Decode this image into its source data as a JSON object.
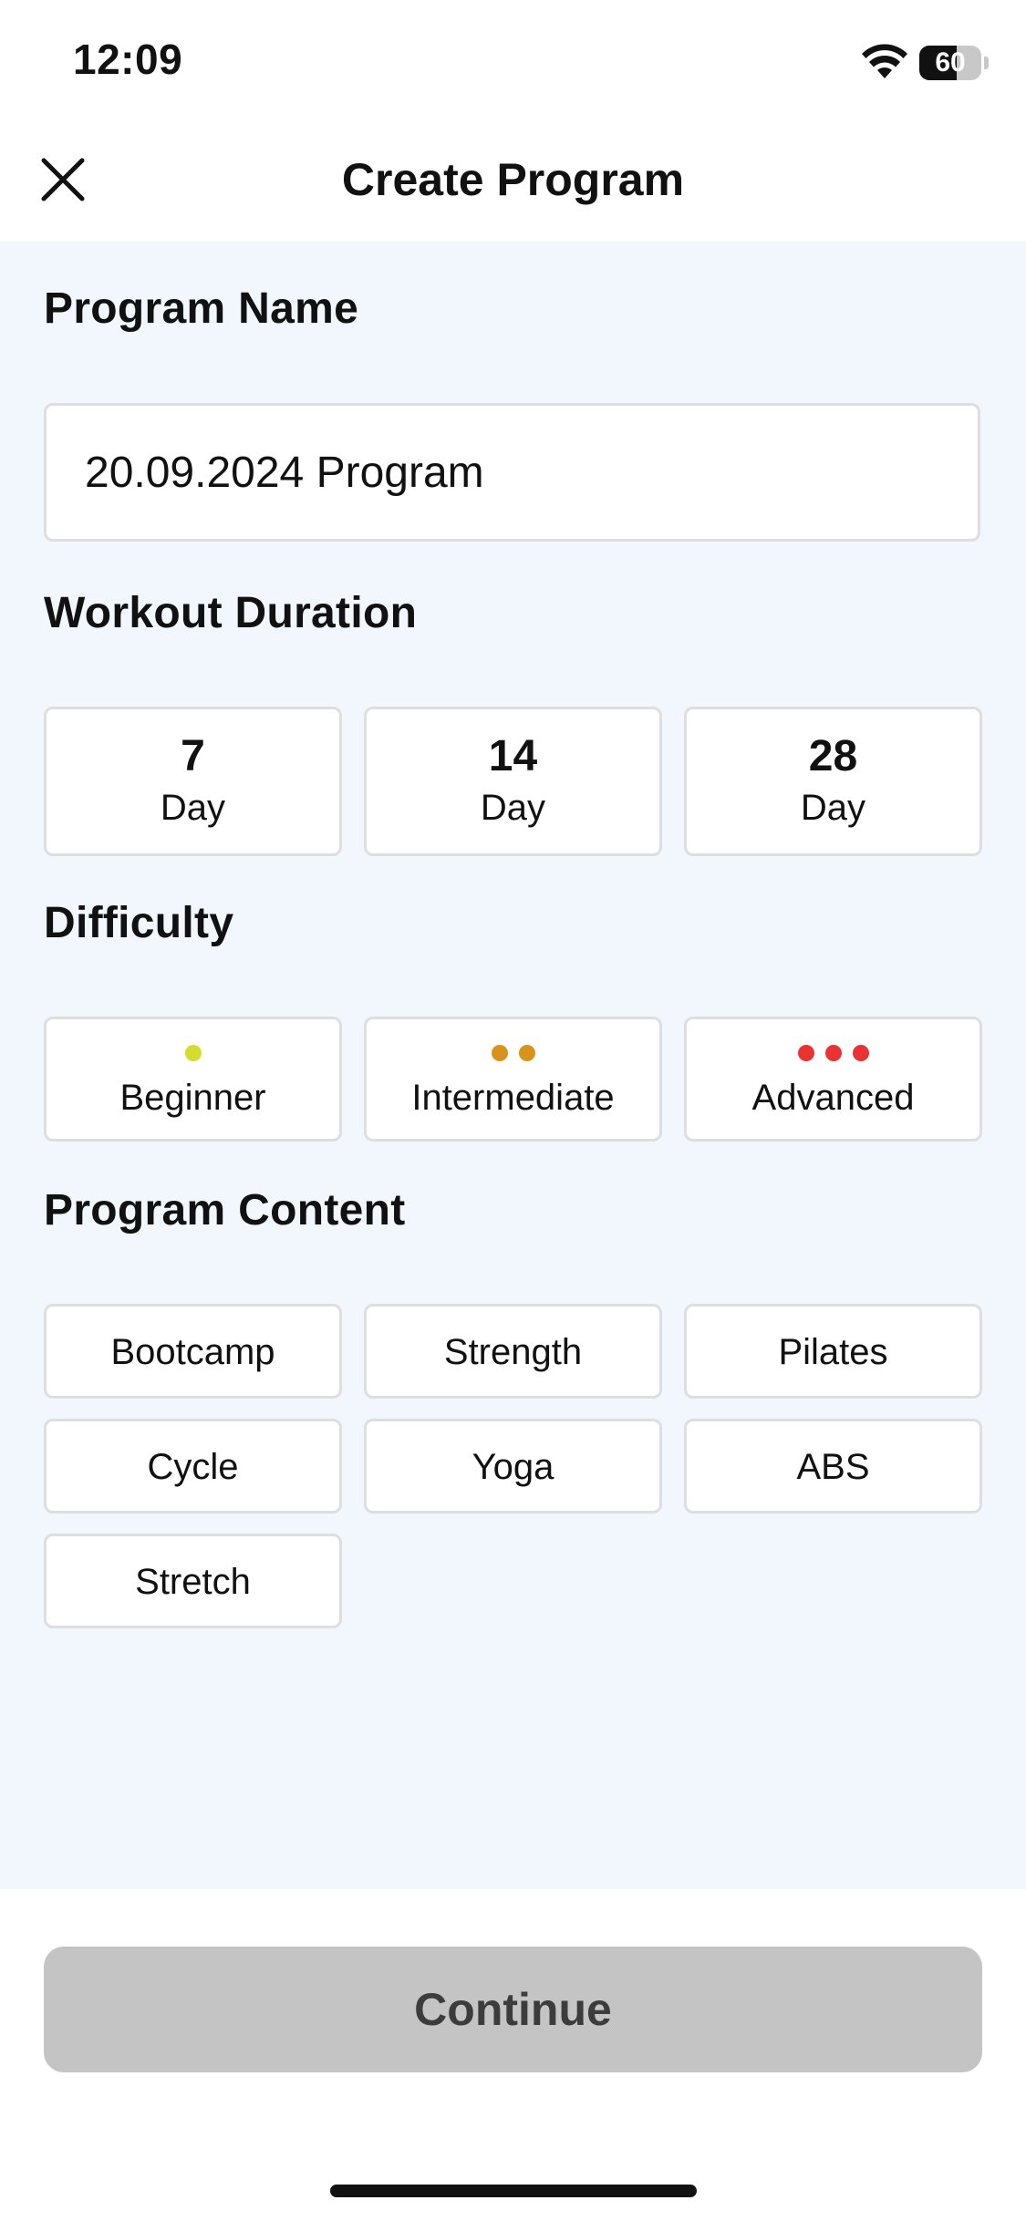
{
  "status_bar": {
    "time": "12:09",
    "battery_level": "60",
    "battery_fraction": 0.6
  },
  "header": {
    "title": "Create Program"
  },
  "program_name": {
    "label": "Program Name",
    "value": "20.09.2024 Program"
  },
  "duration": {
    "label": "Workout Duration",
    "options": [
      {
        "number": "7",
        "unit": "Day"
      },
      {
        "number": "14",
        "unit": "Day"
      },
      {
        "number": "28",
        "unit": "Day"
      }
    ]
  },
  "difficulty": {
    "label": "Difficulty",
    "options": [
      {
        "label": "Beginner",
        "dots": 1,
        "color": "#d4dc2e"
      },
      {
        "label": "Intermediate",
        "dots": 2,
        "color": "#d9931c"
      },
      {
        "label": "Advanced",
        "dots": 3,
        "color": "#ea3232"
      }
    ]
  },
  "content": {
    "label": "Program Content",
    "options": [
      "Bootcamp",
      "Strength",
      "Pilates",
      "Cycle",
      "Yoga",
      "ABS",
      "Stretch"
    ]
  },
  "footer": {
    "continue_label": "Continue"
  },
  "colors": {
    "content_background": "#f2f7fe",
    "card_border": "#dedede",
    "button_disabled": "#c4c4c4"
  }
}
